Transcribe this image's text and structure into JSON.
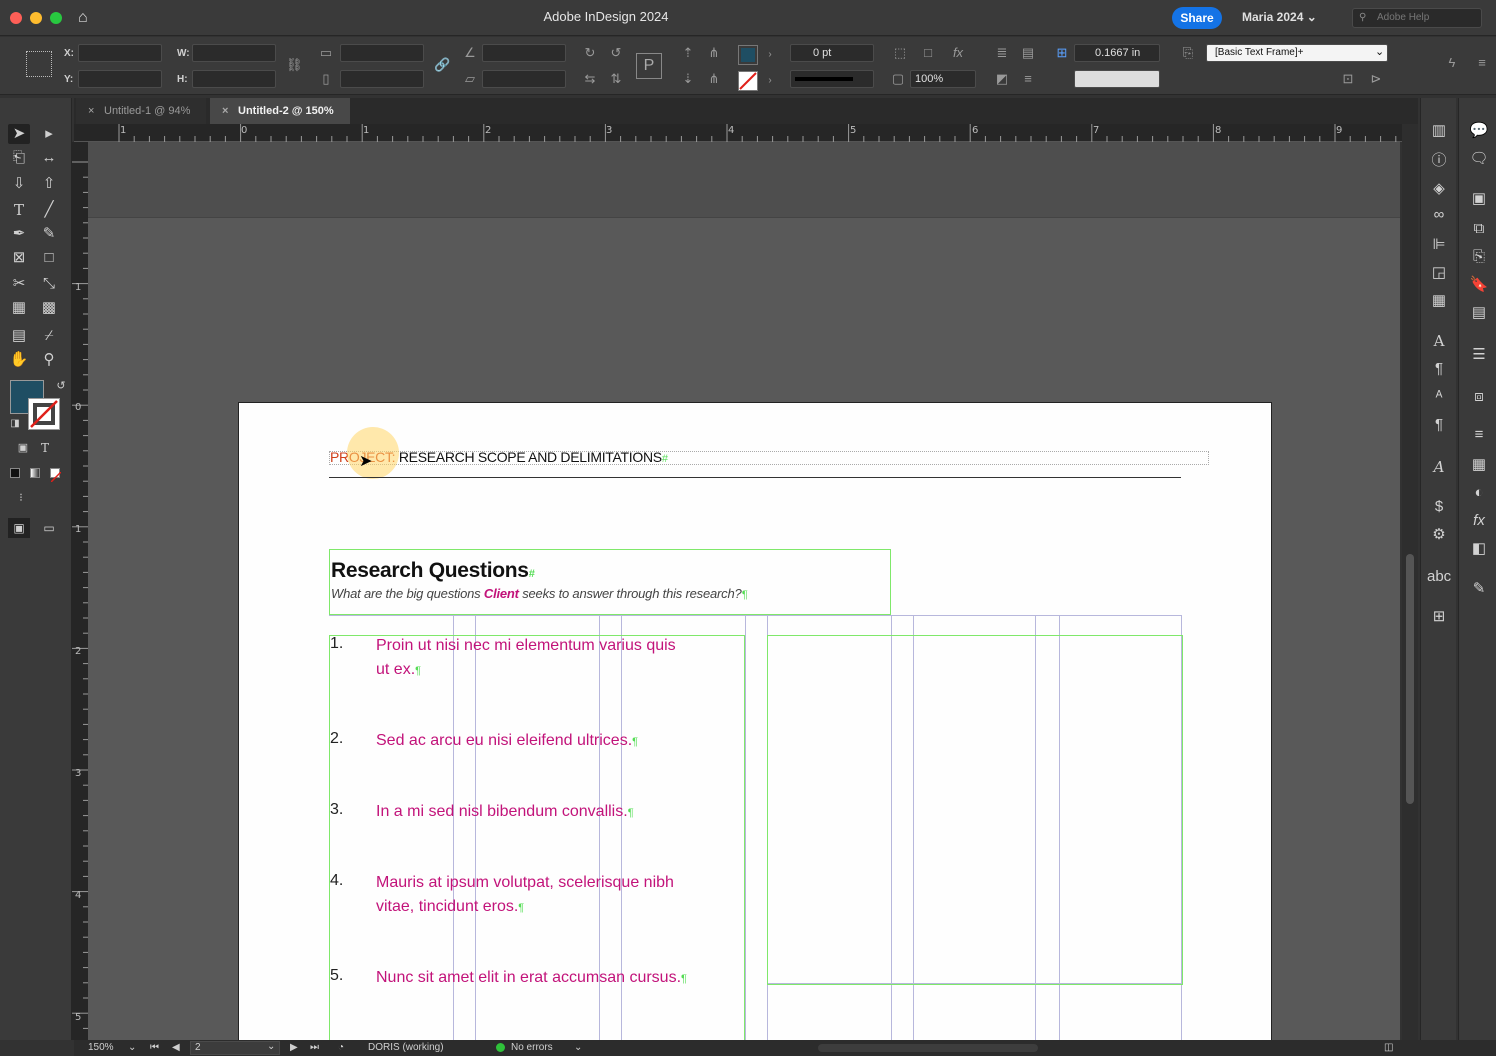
{
  "window": {
    "title": "Adobe InDesign 2024",
    "share_label": "Share",
    "user": "Maria 2024",
    "help_placeholder": "Adobe Help"
  },
  "control": {
    "x_label": "X:",
    "y_label": "Y:",
    "w_label": "W:",
    "h_label": "H:",
    "stroke_weight": "0 pt",
    "scale": "100%",
    "gutter": "0.1667 in",
    "object_style": "[Basic Text Frame]+",
    "fill_color": "#1f4e63"
  },
  "tabs": [
    {
      "label": "Untitled-1 @ 94%",
      "active": false
    },
    {
      "label": "Untitled-2 @ 150%",
      "active": true
    }
  ],
  "ruler": {
    "top": [
      "1",
      "0",
      "1",
      "2",
      "3",
      "4",
      "5",
      "6",
      "7",
      "8",
      "9"
    ],
    "left": [
      "1",
      "0",
      "1",
      "2",
      "3",
      "4",
      "5"
    ]
  },
  "document": {
    "header_project": "PROJECT:",
    "header_title": " RESEARCH SCOPE AND DELIMITATIONS",
    "heading": "Research Questions",
    "subhead_pre": "What are the big questions ",
    "subhead_client": "Client",
    "subhead_post": " seeks to answer through this research?",
    "questions": [
      {
        "num": "1.",
        "line1": "Proin ut nisi nec mi elementum varius quis",
        "line2": "ut ex."
      },
      {
        "num": "2.",
        "line1": "Sed ac arcu eu nisi eleifend ultrices.",
        "line2": ""
      },
      {
        "num": "3.",
        "line1": "In a mi sed nisl bibendum convallis.",
        "line2": ""
      },
      {
        "num": "4.",
        "line1": "Mauris at ipsum volutpat, scelerisque nibh",
        "line2": "vitae, tincidunt eros."
      },
      {
        "num": "5.",
        "line1": "Nunc sit amet elit in erat accumsan cursus.",
        "line2": ""
      }
    ]
  },
  "status": {
    "zoom": "150%",
    "page": "2",
    "profile": "DORIS (working)",
    "errors": "No errors"
  },
  "colors": {
    "accent": "#c2137a",
    "frame": "#7fe86a",
    "share": "#1473e6"
  }
}
